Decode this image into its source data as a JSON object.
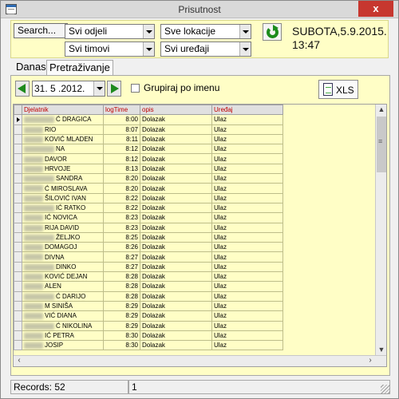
{
  "window": {
    "title": "Prisutnost",
    "close_label": "x"
  },
  "filters": {
    "search_label": "Search...",
    "department": "Svi odjeli",
    "location": "Sve lokacije",
    "team": "Svi timovi",
    "device": "Svi uređaji",
    "datetime_line1": "SUBOTA,5.9.2015.",
    "datetime_line2": "13:47"
  },
  "tabs": {
    "inactive": "Danas",
    "active": "Pretraživanje"
  },
  "toolbar": {
    "date_value": "31. 5 .2012.",
    "group_label": "Grupiraj po imenu",
    "group_checked": false,
    "xls_label": "XLS"
  },
  "grid": {
    "columns": [
      "Djelatnik",
      "logTime",
      "opis",
      "Uređaj"
    ],
    "rows": [
      {
        "name": "Ć DRAGICA",
        "time": "8:00",
        "desc": "Dolazak",
        "device": "Ulaz"
      },
      {
        "name": "RIO",
        "time": "8:07",
        "desc": "Dolazak",
        "device": "Ulaz"
      },
      {
        "name": "KOVIĆ MLADEN",
        "time": "8:11",
        "desc": "Dolazak",
        "device": "Ulaz"
      },
      {
        "name": "NA",
        "time": "8:12",
        "desc": "Dolazak",
        "device": "Ulaz"
      },
      {
        "name": "DAVOR",
        "time": "8:12",
        "desc": "Dolazak",
        "device": "Ulaz"
      },
      {
        "name": "HRVOJE",
        "time": "8:13",
        "desc": "Dolazak",
        "device": "Ulaz"
      },
      {
        "name": "SANDRA",
        "time": "8:20",
        "desc": "Dolazak",
        "device": "Ulaz"
      },
      {
        "name": "Ć MIROSLAVA",
        "time": "8:20",
        "desc": "Dolazak",
        "device": "Ulaz"
      },
      {
        "name": "ŠILOVIĆ IVAN",
        "time": "8:22",
        "desc": "Dolazak",
        "device": "Ulaz"
      },
      {
        "name": "IĆ RATKO",
        "time": "8:22",
        "desc": "Dolazak",
        "device": "Ulaz"
      },
      {
        "name": "IĆ NOVICA",
        "time": "8:23",
        "desc": "Dolazak",
        "device": "Ulaz"
      },
      {
        "name": "RIJA DAVID",
        "time": "8:23",
        "desc": "Dolazak",
        "device": "Ulaz"
      },
      {
        "name": "ŽELJKO",
        "time": "8:25",
        "desc": "Dolazak",
        "device": "Ulaz"
      },
      {
        "name": "DOMAGOJ",
        "time": "8:26",
        "desc": "Dolazak",
        "device": "Ulaz"
      },
      {
        "name": "DIVNA",
        "time": "8:27",
        "desc": "Dolazak",
        "device": "Ulaz"
      },
      {
        "name": "DINKO",
        "time": "8:27",
        "desc": "Dolazak",
        "device": "Ulaz"
      },
      {
        "name": "KOVIĆ DEJAN",
        "time": "8:28",
        "desc": "Dolazak",
        "device": "Ulaz"
      },
      {
        "name": "ALEN",
        "time": "8:28",
        "desc": "Dolazak",
        "device": "Ulaz"
      },
      {
        "name": "Ć DARIJO",
        "time": "8:28",
        "desc": "Dolazak",
        "device": "Ulaz"
      },
      {
        "name": "M SINIŠA",
        "time": "8:29",
        "desc": "Dolazak",
        "device": "Ulaz"
      },
      {
        "name": "VIĆ DIANA",
        "time": "8:29",
        "desc": "Dolazak",
        "device": "Ulaz"
      },
      {
        "name": "Ć NIKOLINA",
        "time": "8:29",
        "desc": "Dolazak",
        "device": "Ulaz"
      },
      {
        "name": "IĆ PETRA",
        "time": "8:30",
        "desc": "Dolazak",
        "device": "Ulaz"
      },
      {
        "name": "JOSIP",
        "time": "8:30",
        "desc": "Dolazak",
        "device": "Ulaz"
      }
    ]
  },
  "status": {
    "records": "Records: 52",
    "position": "1"
  },
  "colors": {
    "panel_bg": "#fffec6",
    "header_text": "#c00000",
    "close_bg": "#c7372f",
    "nav_arrow": "#1e8a1e"
  }
}
